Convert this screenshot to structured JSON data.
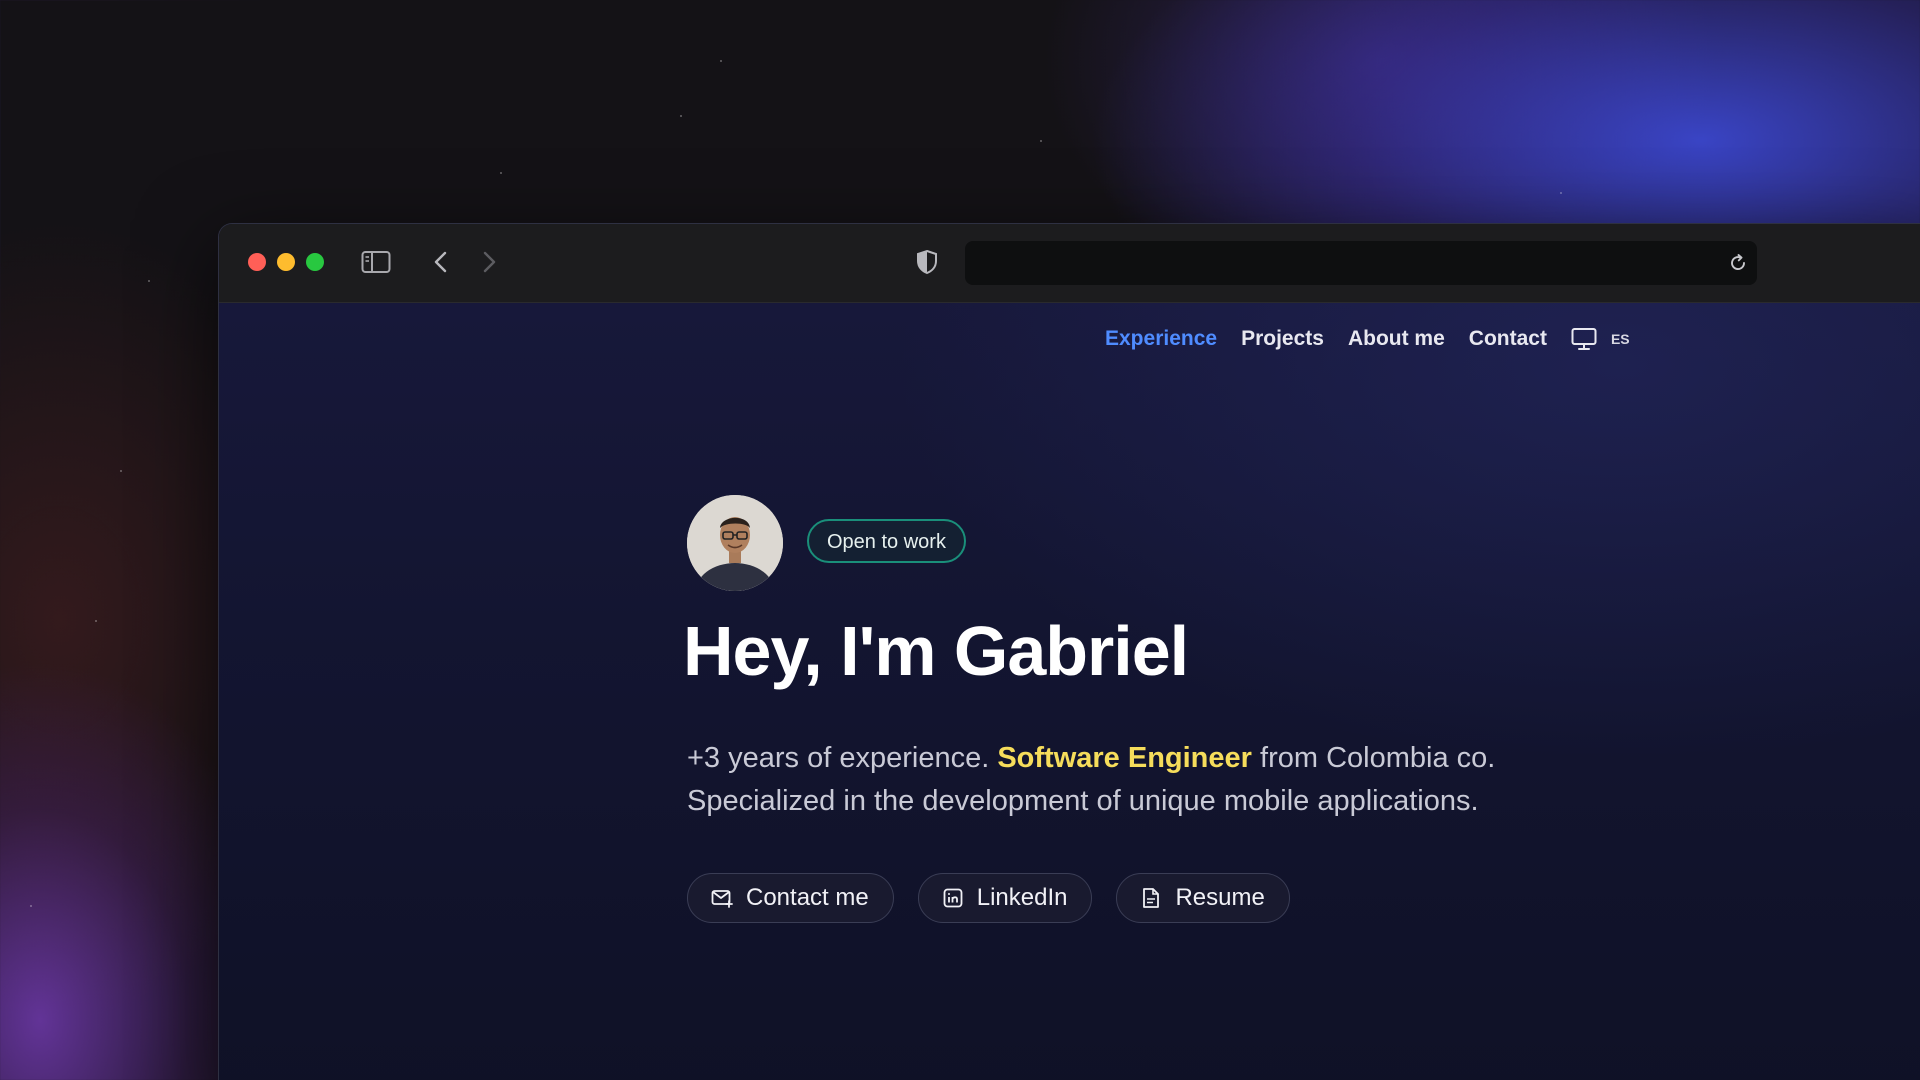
{
  "browser": {
    "url": "",
    "traffic_lights": {
      "close": "#ff5f57",
      "minimize": "#febc2e",
      "zoom": "#28c840"
    }
  },
  "nav": {
    "items": [
      {
        "label": "Experience",
        "active": true
      },
      {
        "label": "Projects",
        "active": false
      },
      {
        "label": "About me",
        "active": false
      },
      {
        "label": "Contact",
        "active": false
      }
    ],
    "theme_icon": "monitor-icon",
    "language": "ES"
  },
  "hero": {
    "badge": "Open to work",
    "title": "Hey, I'm Gabriel",
    "subtitle_part1": "+3 years of experience. ",
    "subtitle_highlight": "Software Engineer",
    "subtitle_part2": " from Colombia co. Specialized in the development of unique mobile applications."
  },
  "buttons": {
    "contact": "Contact me",
    "linkedin": "LinkedIn",
    "resume": "Resume"
  },
  "colors": {
    "accent": "#4f8cff",
    "highlight": "#f6dd5b",
    "badge_border": "#1a8f7a"
  }
}
